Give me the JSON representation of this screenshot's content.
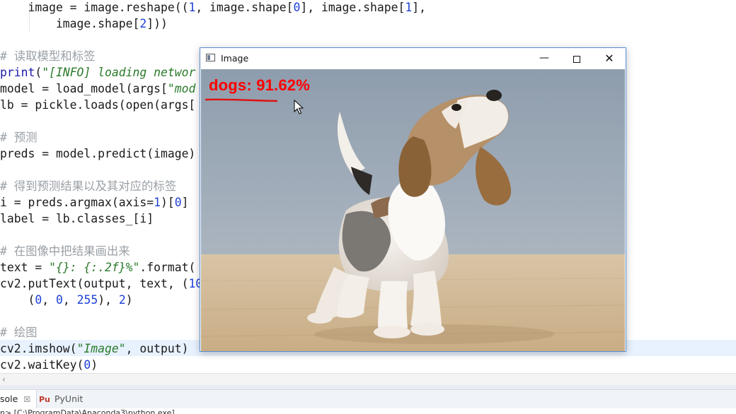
{
  "editor": {
    "lines": [
      {
        "segments": [
          {
            "t": "    image = image.reshape((",
            "c": ""
          },
          {
            "t": "1",
            "c": "nm"
          },
          {
            "t": ", image.shape[",
            "c": ""
          },
          {
            "t": "0",
            "c": "nm"
          },
          {
            "t": "], image.shape[",
            "c": ""
          },
          {
            "t": "1",
            "c": "nm"
          },
          {
            "t": "],",
            "c": ""
          }
        ]
      },
      {
        "segments": [
          {
            "t": "        image.shape[",
            "c": ""
          },
          {
            "t": "2",
            "c": "nm"
          },
          {
            "t": "]))",
            "c": ""
          }
        ]
      },
      {
        "segments": []
      },
      {
        "segments": [
          {
            "t": "# 读取模型和标签",
            "c": "cm"
          }
        ]
      },
      {
        "segments": [
          {
            "t": "print",
            "c": "kw"
          },
          {
            "t": "(",
            "c": ""
          },
          {
            "t": "\"[INFO] loading networ",
            "c": "st"
          }
        ]
      },
      {
        "segments": [
          {
            "t": "model = load_model(args[",
            "c": ""
          },
          {
            "t": "\"mod",
            "c": "st"
          }
        ]
      },
      {
        "segments": [
          {
            "t": "lb = pickle.loads(open(args[",
            "c": ""
          }
        ]
      },
      {
        "segments": []
      },
      {
        "segments": [
          {
            "t": "# 预测",
            "c": "cm"
          }
        ]
      },
      {
        "segments": [
          {
            "t": "preds = model.predict(image)",
            "c": ""
          }
        ]
      },
      {
        "segments": []
      },
      {
        "segments": [
          {
            "t": "# 得到预测结果以及其对应的标签",
            "c": "cm"
          }
        ]
      },
      {
        "segments": [
          {
            "t": "i = preds.argmax(axis=",
            "c": ""
          },
          {
            "t": "1",
            "c": "nm"
          },
          {
            "t": ")[",
            "c": ""
          },
          {
            "t": "0",
            "c": "nm"
          },
          {
            "t": "]",
            "c": ""
          }
        ]
      },
      {
        "segments": [
          {
            "t": "label = lb.classes_[i]",
            "c": ""
          }
        ]
      },
      {
        "segments": []
      },
      {
        "segments": [
          {
            "t": "# 在图像中把结果画出来",
            "c": "cm"
          }
        ]
      },
      {
        "segments": [
          {
            "t": "text = ",
            "c": ""
          },
          {
            "t": "\"{}: {:.2f}%\"",
            "c": "st"
          },
          {
            "t": ".format(",
            "c": ""
          }
        ]
      },
      {
        "segments": [
          {
            "t": "cv2.putText(output, text, (",
            "c": ""
          },
          {
            "t": "10",
            "c": "nm"
          }
        ]
      },
      {
        "segments": [
          {
            "t": "    (",
            "c": ""
          },
          {
            "t": "0",
            "c": "nm"
          },
          {
            "t": ", ",
            "c": ""
          },
          {
            "t": "0",
            "c": "nm"
          },
          {
            "t": ", ",
            "c": ""
          },
          {
            "t": "255",
            "c": "nm"
          },
          {
            "t": "), ",
            "c": ""
          },
          {
            "t": "2",
            "c": "nm"
          },
          {
            "t": ")",
            "c": ""
          }
        ]
      },
      {
        "segments": []
      },
      {
        "segments": [
          {
            "t": "# 绘图",
            "c": "cm"
          }
        ]
      },
      {
        "segments": [
          {
            "t": "cv2.imshow(",
            "c": ""
          },
          {
            "t": "\"Image\"",
            "c": "st"
          },
          {
            "t": ", output)",
            "c": ""
          }
        ]
      },
      {
        "segments": [
          {
            "t": "cv2.waitKey(",
            "c": ""
          },
          {
            "t": "0",
            "c": "nm"
          },
          {
            "t": ")",
            "c": ""
          }
        ]
      }
    ]
  },
  "bottom_panel": {
    "tabs": [
      {
        "label": "sole",
        "close": "☒"
      },
      {
        "label": "PyUnit",
        "icon": "Pu"
      }
    ],
    "console_path": "n> [C:\\ProgramData\\Anaconda3\\python.exe]",
    "scroll_arrow": "‹"
  },
  "image_window": {
    "title": "Image",
    "minimize_glyph": "—",
    "close_glyph": "✕",
    "prediction_text": "dogs: 91.62%",
    "photo_subject": "beagle puppy on wooden floor, howling upward"
  },
  "colors": {
    "prediction": "#ff0000",
    "comment": "#9aa0a6",
    "string": "#2a7a2a",
    "number": "#1c3fd6",
    "keyword": "#1a1aa6",
    "window_border": "#5a8fd0",
    "current_line": "#e8f2fe"
  }
}
